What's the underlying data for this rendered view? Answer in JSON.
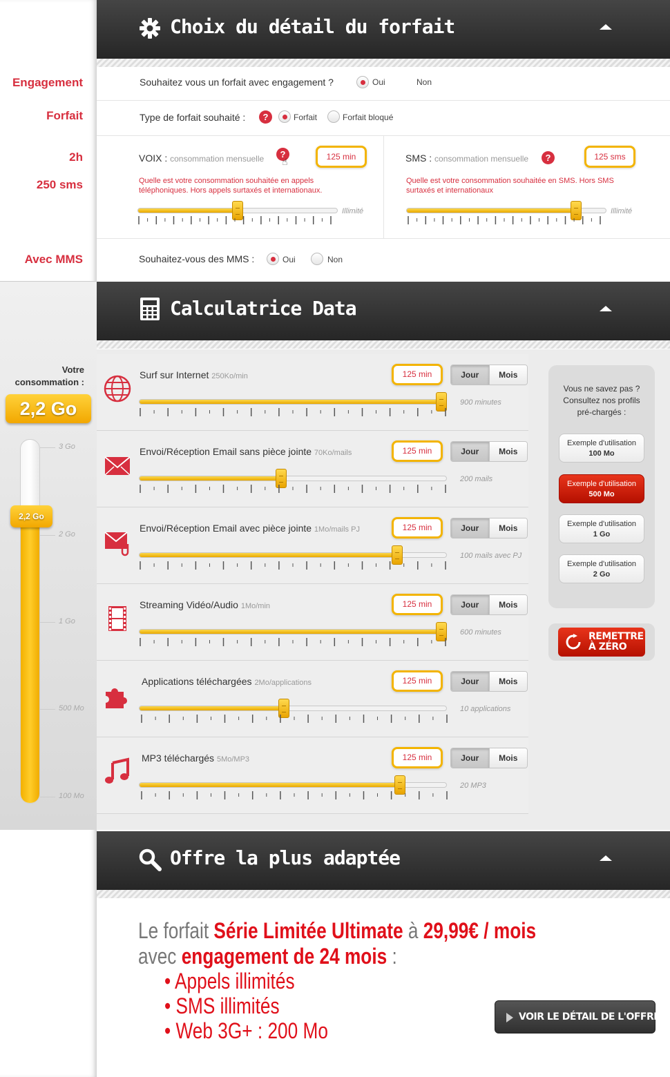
{
  "sidebar": {
    "engagement": "Engagement",
    "forfait": "Forfait",
    "voix": "2h",
    "sms": "250 sms",
    "mms": "Avec MMS",
    "conso_label_1": "Votre",
    "conso_label_2": "consommation :",
    "conso_value": "2,2 Go",
    "gauge": {
      "value_label": "2,2 Go",
      "level": 0.81,
      "ticks": [
        "3 Go",
        "2 Go",
        "1 Go",
        "500 Mo",
        "100 Mo"
      ]
    }
  },
  "section1": {
    "title": "Choix du détail du forfait",
    "engagement_question": "Souhaitez vous un forfait avec engagement ?",
    "engagement_oui": "Oui",
    "engagement_non": "Non",
    "type_question": "Type de forfait souhaité :",
    "type_forfait": "Forfait",
    "type_bloque": "Forfait bloqué",
    "voix_title": "VOIX :",
    "voix_sub": "consommation mensuelle",
    "voix_value": "125 min",
    "voix_help_1": "Quelle est votre consommation souhaitée en appels",
    "voix_help_2": "téléphoniques. Hors appels surtaxés et internationaux.",
    "voix_max": "Illimité",
    "voix_level": 0.5,
    "sms_title": "SMS :",
    "sms_sub": "consommation mensuelle",
    "sms_value": "125 sms",
    "sms_help_1": "Quelle est votre consommation souhaitée en SMS. Hors SMS",
    "sms_help_2": "surtaxés et internationaux",
    "sms_max": "Illimité",
    "sms_level": 0.87,
    "mms_question": "Souhaitez-vous des MMS :",
    "mms_oui": "Oui",
    "mms_non": "Non"
  },
  "section2": {
    "title": "Calculatrice Data",
    "jour": "Jour",
    "mois": "Mois",
    "rows": [
      {
        "label": "Surf sur Internet",
        "unit": "250Ko/min",
        "value": "125 min",
        "caption": "900 minutes",
        "level": 1.0,
        "icon": "globe-icon"
      },
      {
        "label": "Envoi/Réception Email sans pièce jointe",
        "unit": "70Ko/mails",
        "value": "125 min",
        "caption": "200 mails",
        "level": 0.46,
        "icon": "mail-icon"
      },
      {
        "label": "Envoi/Réception Email avec pièce jointe",
        "unit": "1Mo/mails PJ",
        "value": "125 min",
        "caption": "100 mails avec PJ",
        "level": 0.85,
        "icon": "mail-attachment-icon"
      },
      {
        "label": "Streaming Vidéo/Audio",
        "unit": "1Mo/min",
        "value": "125 min",
        "caption": "600 minutes",
        "level": 1.0,
        "icon": "film-icon"
      },
      {
        "label": "Applications téléchargées",
        "unit": "2Mo/applications",
        "value": "125 min",
        "caption": "10 applications",
        "level": 0.47,
        "icon": "puzzle-icon"
      },
      {
        "label": "MP3 téléchargés",
        "unit": "5Mo/MP3",
        "value": "125 min",
        "caption": "20 MP3",
        "level": 0.86,
        "icon": "music-note-icon"
      }
    ],
    "profiles_intro_1": "Vous ne savez pas ?",
    "profiles_intro_2": "Consultez nos profils",
    "profiles_intro_3": "pré-chargés :",
    "profile_prefix": "Exemple d'utilisation",
    "profiles": [
      "100 Mo",
      "500 Mo",
      "1 Go",
      "2 Go"
    ],
    "reset_1": "REMETTRE",
    "reset_2": "À ZÉRO"
  },
  "section3": {
    "title": "Offre la plus adaptée",
    "l1_a": "Le forfait ",
    "l1_b": "Série Limitée Ultimate",
    "l1_c": " à ",
    "l1_d": "29,99€ / mois",
    "l2_a": "avec ",
    "l2_b": "engagement de 24 mois",
    "l2_c": " :",
    "bullets": [
      "Appels illimités",
      "SMS illimités",
      "Web 3G+ : 200 Mo"
    ],
    "button": "VOIR LE DÉTAIL DE L'OFFRE"
  },
  "colors": {
    "accent_red": "#d72f3f",
    "gauge_yellow": "#f3b400",
    "header_dark": "#2f2f2f"
  }
}
